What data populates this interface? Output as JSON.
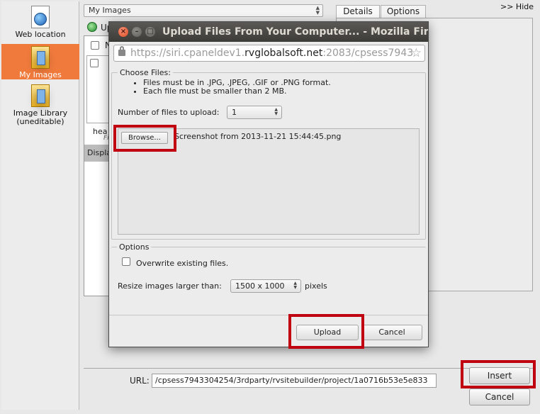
{
  "sidebar": {
    "items": [
      {
        "label": "Web location",
        "icon": "web-location-icon"
      },
      {
        "label": "My Images",
        "icon": "my-images-folder-icon",
        "active": true
      },
      {
        "label": "Image Library (uneditable)",
        "icon": "image-library-folder-icon"
      }
    ],
    "active_color": "#f07a3c"
  },
  "background": {
    "source_select": "My Images",
    "tabs": [
      "Details",
      "Options"
    ],
    "hide_link": ">> Hide",
    "upload_text": "Up",
    "list_header_text": "N",
    "thumb_name": "hea",
    "thumb_sub": "Fi",
    "display_text": "Displa",
    "url_label": "URL:",
    "url_value": "/cpsess7943304254/3rdparty/rvsitebuilder/project/1a0716b53e5e833",
    "insert_label": "Insert",
    "cancel_label": "Cancel"
  },
  "modal": {
    "title": "Upload Files From Your Computer... - Mozilla Firef",
    "url_prefix": "https://siri.cpaneldev1.",
    "url_domain": "rvglobalsoft.net",
    "url_suffix": ":2083/cpsess7943",
    "choose_legend": "Choose Files:",
    "rules": [
      "Files must be in .JPG, .JPEG, .GIF or .PNG format.",
      "Each file must be smaller than 2 MB."
    ],
    "num_files_label": "Number of files to upload:",
    "num_files_value": "1",
    "browse_label": "Browse...",
    "file_name": "Screenshot from 2013-11-21 15:44:45.png",
    "options_legend": "Options",
    "overwrite_label": "Overwrite existing files.",
    "resize_label": "Resize images larger than:",
    "resize_value": "1500 x 1000",
    "resize_unit": "pixels",
    "upload_label": "Upload",
    "cancel_label": "Cancel"
  },
  "colors": {
    "highlight": "#c00010",
    "titlebar": "#3c3b37",
    "close_button": "#dc4a20"
  }
}
